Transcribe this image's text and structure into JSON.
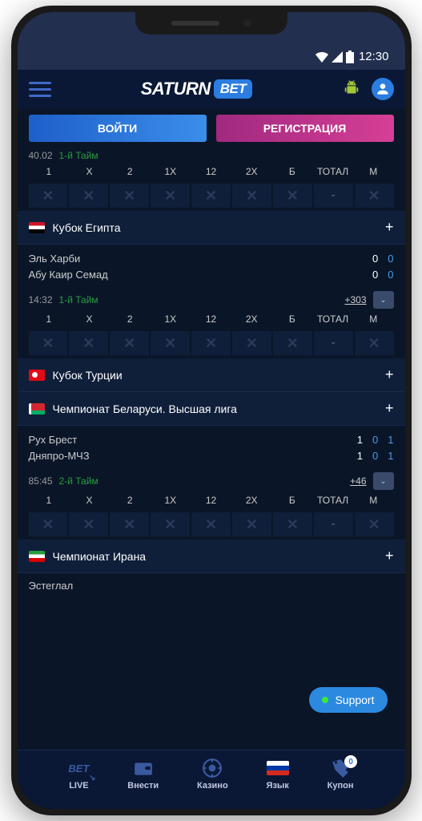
{
  "status": {
    "time": "12:30"
  },
  "logo": {
    "text": "SATURN",
    "badge": "BET"
  },
  "auth": {
    "login": "ВОЙТИ",
    "register": "РЕГИСТРАЦИЯ"
  },
  "odds_labels": [
    "1",
    "X",
    "2",
    "1X",
    "12",
    "2X",
    "Б",
    "ТОТАЛ",
    "М"
  ],
  "top": {
    "time": "40.02",
    "period": "1-й Тайм"
  },
  "leagues": [
    {
      "name": "Кубок Египта",
      "flag": "egypt"
    },
    {
      "name": "Кубок Турции",
      "flag": "turkey"
    },
    {
      "name": "Чемпионат Беларуси. Высшая лига",
      "flag": "belarus"
    },
    {
      "name": "Чемпионат Ирана",
      "flag": "iran"
    }
  ],
  "match1": {
    "team1": "Эль Харби",
    "team2": "Абу Каир Семад",
    "s1a": "0",
    "s1b": "0",
    "s2a": "0",
    "s2b": "0",
    "time": "14:32",
    "period": "1-й Тайм",
    "more": "+303"
  },
  "match2": {
    "team1": "Рух Брест",
    "team2": "Дняпро-МЧЗ",
    "s1a": "1",
    "s1b": "0",
    "s1c": "1",
    "s2a": "1",
    "s2b": "0",
    "s2c": "1",
    "time": "85:45",
    "period": "2-й Тайм",
    "more": "+46"
  },
  "match3": {
    "team1": "Эстеглал"
  },
  "support": "Support",
  "nav": {
    "live": "LIVE",
    "deposit": "Внести",
    "casino": "Казино",
    "lang": "Язык",
    "coupon": "Купон",
    "coupon_count": "0",
    "bet_label": "BET"
  }
}
